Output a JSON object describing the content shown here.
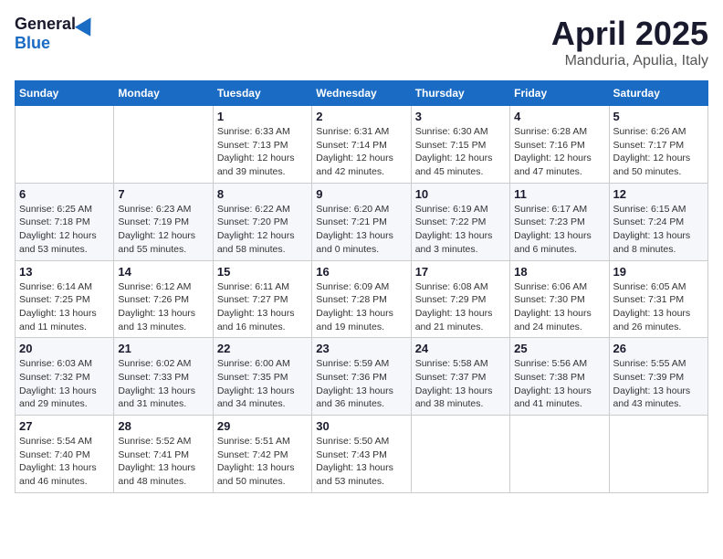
{
  "header": {
    "logo_general": "General",
    "logo_blue": "Blue",
    "title": "April 2025",
    "location": "Manduria, Apulia, Italy"
  },
  "days_of_week": [
    "Sunday",
    "Monday",
    "Tuesday",
    "Wednesday",
    "Thursday",
    "Friday",
    "Saturday"
  ],
  "weeks": [
    [
      {
        "day": "",
        "info": ""
      },
      {
        "day": "",
        "info": ""
      },
      {
        "day": "1",
        "info": "Sunrise: 6:33 AM\nSunset: 7:13 PM\nDaylight: 12 hours\nand 39 minutes."
      },
      {
        "day": "2",
        "info": "Sunrise: 6:31 AM\nSunset: 7:14 PM\nDaylight: 12 hours\nand 42 minutes."
      },
      {
        "day": "3",
        "info": "Sunrise: 6:30 AM\nSunset: 7:15 PM\nDaylight: 12 hours\nand 45 minutes."
      },
      {
        "day": "4",
        "info": "Sunrise: 6:28 AM\nSunset: 7:16 PM\nDaylight: 12 hours\nand 47 minutes."
      },
      {
        "day": "5",
        "info": "Sunrise: 6:26 AM\nSunset: 7:17 PM\nDaylight: 12 hours\nand 50 minutes."
      }
    ],
    [
      {
        "day": "6",
        "info": "Sunrise: 6:25 AM\nSunset: 7:18 PM\nDaylight: 12 hours\nand 53 minutes."
      },
      {
        "day": "7",
        "info": "Sunrise: 6:23 AM\nSunset: 7:19 PM\nDaylight: 12 hours\nand 55 minutes."
      },
      {
        "day": "8",
        "info": "Sunrise: 6:22 AM\nSunset: 7:20 PM\nDaylight: 12 hours\nand 58 minutes."
      },
      {
        "day": "9",
        "info": "Sunrise: 6:20 AM\nSunset: 7:21 PM\nDaylight: 13 hours\nand 0 minutes."
      },
      {
        "day": "10",
        "info": "Sunrise: 6:19 AM\nSunset: 7:22 PM\nDaylight: 13 hours\nand 3 minutes."
      },
      {
        "day": "11",
        "info": "Sunrise: 6:17 AM\nSunset: 7:23 PM\nDaylight: 13 hours\nand 6 minutes."
      },
      {
        "day": "12",
        "info": "Sunrise: 6:15 AM\nSunset: 7:24 PM\nDaylight: 13 hours\nand 8 minutes."
      }
    ],
    [
      {
        "day": "13",
        "info": "Sunrise: 6:14 AM\nSunset: 7:25 PM\nDaylight: 13 hours\nand 11 minutes."
      },
      {
        "day": "14",
        "info": "Sunrise: 6:12 AM\nSunset: 7:26 PM\nDaylight: 13 hours\nand 13 minutes."
      },
      {
        "day": "15",
        "info": "Sunrise: 6:11 AM\nSunset: 7:27 PM\nDaylight: 13 hours\nand 16 minutes."
      },
      {
        "day": "16",
        "info": "Sunrise: 6:09 AM\nSunset: 7:28 PM\nDaylight: 13 hours\nand 19 minutes."
      },
      {
        "day": "17",
        "info": "Sunrise: 6:08 AM\nSunset: 7:29 PM\nDaylight: 13 hours\nand 21 minutes."
      },
      {
        "day": "18",
        "info": "Sunrise: 6:06 AM\nSunset: 7:30 PM\nDaylight: 13 hours\nand 24 minutes."
      },
      {
        "day": "19",
        "info": "Sunrise: 6:05 AM\nSunset: 7:31 PM\nDaylight: 13 hours\nand 26 minutes."
      }
    ],
    [
      {
        "day": "20",
        "info": "Sunrise: 6:03 AM\nSunset: 7:32 PM\nDaylight: 13 hours\nand 29 minutes."
      },
      {
        "day": "21",
        "info": "Sunrise: 6:02 AM\nSunset: 7:33 PM\nDaylight: 13 hours\nand 31 minutes."
      },
      {
        "day": "22",
        "info": "Sunrise: 6:00 AM\nSunset: 7:35 PM\nDaylight: 13 hours\nand 34 minutes."
      },
      {
        "day": "23",
        "info": "Sunrise: 5:59 AM\nSunset: 7:36 PM\nDaylight: 13 hours\nand 36 minutes."
      },
      {
        "day": "24",
        "info": "Sunrise: 5:58 AM\nSunset: 7:37 PM\nDaylight: 13 hours\nand 38 minutes."
      },
      {
        "day": "25",
        "info": "Sunrise: 5:56 AM\nSunset: 7:38 PM\nDaylight: 13 hours\nand 41 minutes."
      },
      {
        "day": "26",
        "info": "Sunrise: 5:55 AM\nSunset: 7:39 PM\nDaylight: 13 hours\nand 43 minutes."
      }
    ],
    [
      {
        "day": "27",
        "info": "Sunrise: 5:54 AM\nSunset: 7:40 PM\nDaylight: 13 hours\nand 46 minutes."
      },
      {
        "day": "28",
        "info": "Sunrise: 5:52 AM\nSunset: 7:41 PM\nDaylight: 13 hours\nand 48 minutes."
      },
      {
        "day": "29",
        "info": "Sunrise: 5:51 AM\nSunset: 7:42 PM\nDaylight: 13 hours\nand 50 minutes."
      },
      {
        "day": "30",
        "info": "Sunrise: 5:50 AM\nSunset: 7:43 PM\nDaylight: 13 hours\nand 53 minutes."
      },
      {
        "day": "",
        "info": ""
      },
      {
        "day": "",
        "info": ""
      },
      {
        "day": "",
        "info": ""
      }
    ]
  ]
}
